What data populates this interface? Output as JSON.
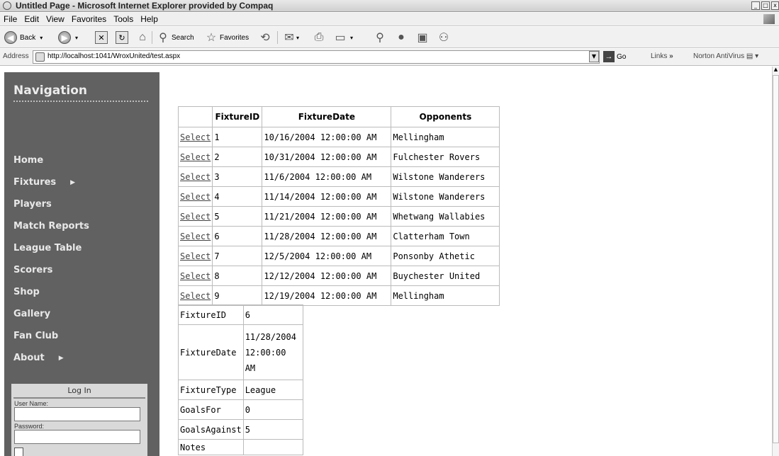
{
  "window": {
    "title": "Untitled Page - Microsoft Internet Explorer provided by Compaq",
    "min_icon": "minimize-icon",
    "max_icon": "maximize-icon",
    "close_icon": "close-icon"
  },
  "menu": [
    "File",
    "Edit",
    "View",
    "Favorites",
    "Tools",
    "Help"
  ],
  "toolbar": {
    "back_label": "Back",
    "search_label": "Search",
    "favorites_label": "Favorites"
  },
  "address": {
    "label": "Address",
    "url": "http://localhost:1041/WroxUnited/test.aspx",
    "go_label": "Go",
    "links_label": "Links",
    "links_chevron": "»",
    "norton_label": "Norton AntiVirus"
  },
  "sidebar": {
    "title": "Navigation",
    "items": [
      {
        "label": "Home",
        "has_arrow": false
      },
      {
        "label": "Fixtures",
        "has_arrow": true
      },
      {
        "label": "Players",
        "has_arrow": false
      },
      {
        "label": "Match Reports",
        "has_arrow": false
      },
      {
        "label": "League Table",
        "has_arrow": false
      },
      {
        "label": "Scorers",
        "has_arrow": false
      },
      {
        "label": "Shop",
        "has_arrow": false
      },
      {
        "label": "Gallery",
        "has_arrow": false
      },
      {
        "label": "Fan Club",
        "has_arrow": false
      },
      {
        "label": "About",
        "has_arrow": true
      }
    ],
    "login": {
      "title": "Log In",
      "username_label": "User Name:",
      "password_label": "Password:"
    }
  },
  "grid": {
    "headers": [
      "",
      "FixtureID",
      "FixtureDate",
      "Opponents"
    ],
    "select_label": "Select",
    "rows": [
      {
        "id": "1",
        "date": "10/16/2004 12:00:00 AM",
        "opponents": "Mellingham"
      },
      {
        "id": "2",
        "date": "10/31/2004 12:00:00 AM",
        "opponents": "Fulchester Rovers"
      },
      {
        "id": "3",
        "date": "11/6/2004 12:00:00 AM",
        "opponents": "Wilstone Wanderers"
      },
      {
        "id": "4",
        "date": "11/14/2004 12:00:00 AM",
        "opponents": "Wilstone Wanderers"
      },
      {
        "id": "5",
        "date": "11/21/2004 12:00:00 AM",
        "opponents": "Whetwang Wallabies"
      },
      {
        "id": "6",
        "date": "11/28/2004 12:00:00 AM",
        "opponents": "Clatterham Town"
      },
      {
        "id": "7",
        "date": "12/5/2004 12:00:00 AM",
        "opponents": "Ponsonby Athetic"
      },
      {
        "id": "8",
        "date": "12/12/2004 12:00:00 AM",
        "opponents": "Buychester United"
      },
      {
        "id": "9",
        "date": "12/19/2004 12:00:00 AM",
        "opponents": "Mellingham"
      }
    ]
  },
  "details": {
    "rows": [
      {
        "field": "FixtureID",
        "value": "6"
      },
      {
        "field": "FixtureDate",
        "value": "11/28/2004 12:00:00 AM"
      },
      {
        "field": "FixtureType",
        "value": "League"
      },
      {
        "field": "GoalsFor",
        "value": "0"
      },
      {
        "field": "GoalsAgainst",
        "value": "5"
      },
      {
        "field": "Notes",
        "value": ""
      }
    ]
  }
}
